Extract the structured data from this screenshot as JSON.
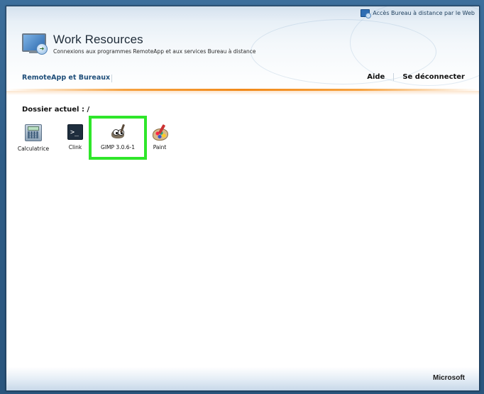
{
  "topbar": {
    "web_access_label": "Accès Bureau à distance par le Web"
  },
  "header": {
    "title": "Work Resources",
    "subtitle": "Connexions aux programmes RemoteApp et aux services Bureau à distance"
  },
  "nav": {
    "remoteapp_label": "RemoteApp et Bureaux",
    "help_label": "Aide",
    "logout_label": "Se déconnecter"
  },
  "content": {
    "current_folder": "Dossier actuel : /",
    "apps": [
      {
        "label": "Calculatrice",
        "icon": "calculator-icon"
      },
      {
        "label": "Clink",
        "icon": "terminal-icon"
      },
      {
        "label": "GIMP 3.0.6-1",
        "icon": "gimp-icon",
        "selected": true
      },
      {
        "label": "Paint",
        "icon": "paint-palette-icon"
      }
    ],
    "highlight_color": "#2fe62a"
  },
  "footer": {
    "brand": "Microsoft"
  },
  "colors": {
    "accent_orange": "#f28a1a",
    "nav_blue": "#1f4e7a"
  }
}
